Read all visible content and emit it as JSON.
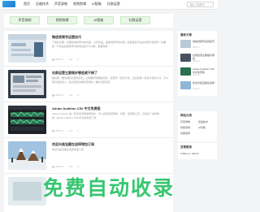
{
  "header": {
    "nav": [
      "首页",
      "压缩技术",
      "声音录制",
      "视频剪辑",
      "AI智能",
      "社群运营"
    ],
    "search_placeholder": "输入关键词"
  },
  "categories": [
    "声音录制",
    "视频剪辑",
    "AI智能",
    "社群运营"
  ],
  "posts": [
    {
      "title": "微信视频号运营技巧",
      "excerpt": "下载长内容，如需将视频号中的内容、以及作品、提取视频号的内容...运营其他平台的内容与视频号一起推送...不管是在视频号中发布的是什么内容，都需保持...",
      "date": "2023-xx",
      "views": "1xx",
      "comments": "0"
    },
    {
      "title": "社群运营主要做好哪些就不掉了",
      "excerpt": "做社群，要先做好社群的定位，社群要有明确的目标...运营有一定的方法，比如说做一些有价值的分享，可以吸引更多的人...建立稳定的群成员结构，做好社群活跃...",
      "date": "2023-xx",
      "views": "1xx",
      "comments": "0"
    },
    {
      "title": "Adobe Audition CS6 中文免费版",
      "excerpt": "Adobe Audition 是一款专业音频编辑软件，可以完成音频录制、剪辑、混音等工作，它提供了多种特效...Adobe Audition CS6 中文版免费下载...",
      "date": "2023-xx",
      "views": "1xx",
      "comments": "0"
    },
    {
      "title": "欢迎光临宝藏在选择增加订阅",
      "excerpt": "欢迎光临宝藏在选择增加订阅...",
      "date": "2023-xx",
      "views": "1xx",
      "comments": "0"
    },
    {
      "title": "",
      "excerpt": "",
      "date": "",
      "views": "",
      "comments": ""
    }
  ],
  "sidebar": {
    "recent_title": "最新文章",
    "recent": [
      {
        "title": "微信视频号运营技巧",
        "date": "2023-xx"
      },
      {
        "title": "社群运营主要做好哪些",
        "date": "2023-xx"
      },
      {
        "title": "Adobe Audition CS6 中文免费版",
        "date": "2023-xx"
      },
      {
        "title": "欢迎光临宝藏在选择",
        "date": "2023-xx"
      }
    ],
    "tags_title": "网站分类",
    "tags": [
      "声音录制",
      "压缩技术",
      "视频剪辑",
      "AI智能",
      "社群运营",
      ""
    ],
    "friend_title": "友情链接",
    "friend_link": "Z-Blog on Github"
  },
  "watermark": "免费自动收录",
  "colors": {
    "accent_green": "#2fc46a",
    "cat_bg": "#e9f6e6",
    "logo_blue": "#1f7dd0"
  }
}
